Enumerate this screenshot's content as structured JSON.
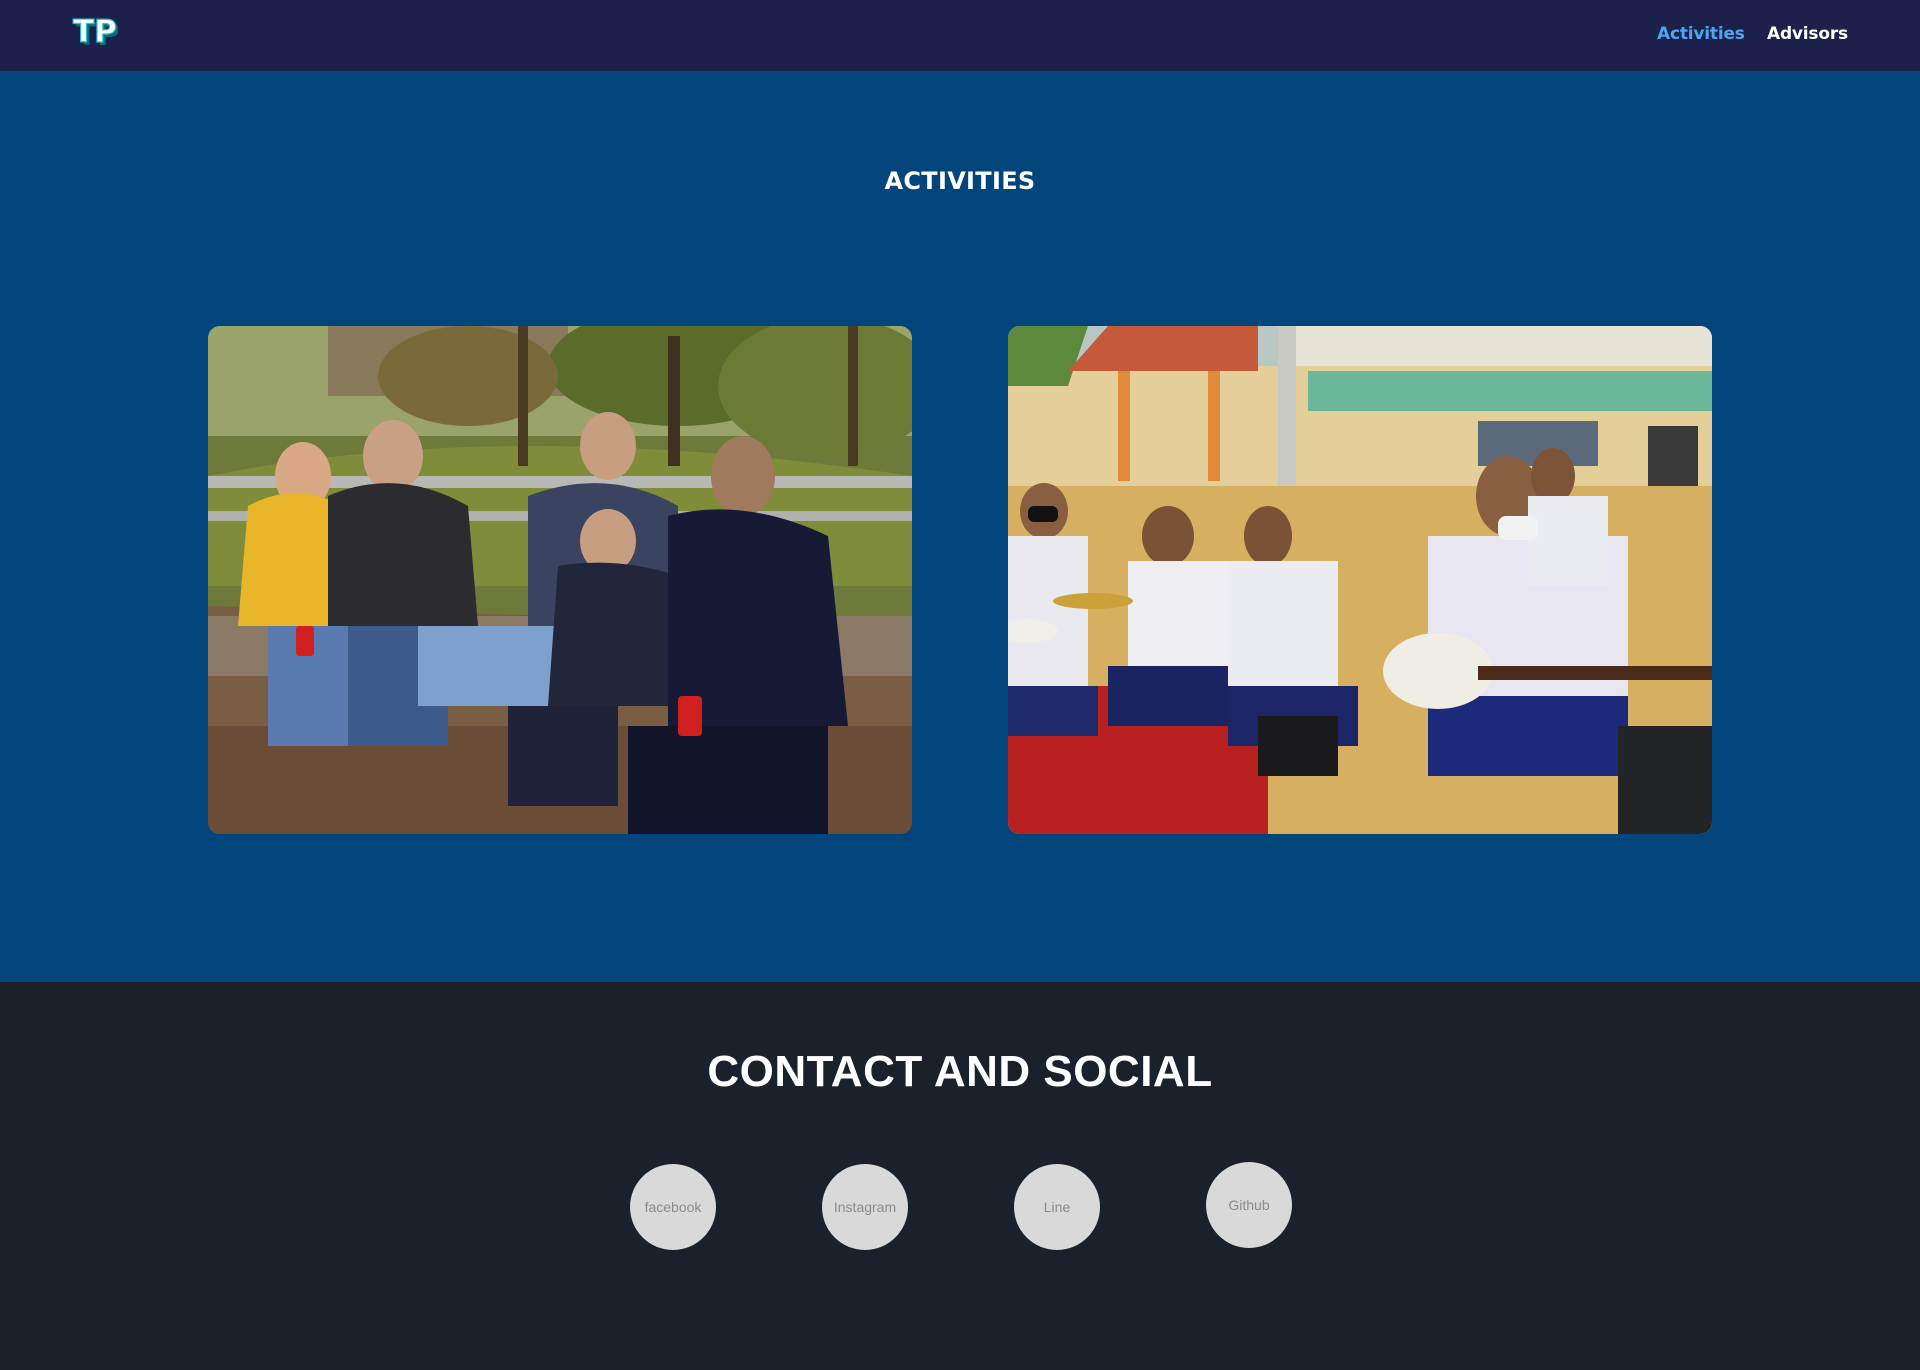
{
  "nav": {
    "logo_text": "TP",
    "links": [
      {
        "label": "Activities",
        "active": true
      },
      {
        "label": "Advisors",
        "active": false
      }
    ]
  },
  "activities": {
    "title": "ACTIVITIES",
    "photos": [
      {
        "subject": "group of friends seated on a low stone wall in an autumn park"
      },
      {
        "subject": "students in white shirts playing drums and guitars in a school pavilion"
      }
    ]
  },
  "contact": {
    "title": "CONTACT AND SOCIAL",
    "links": [
      {
        "label": "facebook"
      },
      {
        "label": "Instagram"
      },
      {
        "label": "Line"
      },
      {
        "label": "Github"
      }
    ]
  },
  "colors": {
    "navbar_bg": "#1c204a",
    "activities_bg": "#02457a",
    "contact_bg": "#1a212b",
    "nav_active": "#4aa8f0",
    "social_button_bg": "#d9d9d9"
  }
}
